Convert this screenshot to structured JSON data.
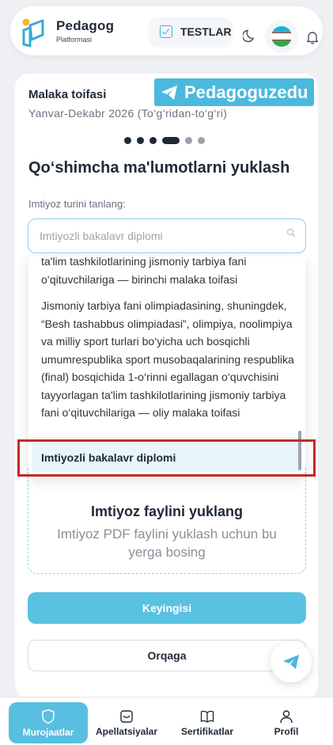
{
  "header": {
    "brand_title": "Pedagog",
    "brand_sub": "Platformasi",
    "tests_label": "TESTLAR",
    "icons": [
      "logo-icon",
      "checkbox-icon",
      "moon-icon",
      "uzbekistan-flag-icon",
      "bell-icon"
    ]
  },
  "slider": {
    "title": "Malaka toifasi",
    "subtitle": "Yanvar-Dekabr 2026 (To‘g‘ridan-to‘g‘ri)",
    "watermark": "Pedagoguzedu"
  },
  "form": {
    "section_title": "Qo‘shimcha ma'lumotlarni yuklash",
    "field_label": "Imtiyoz turini tanlang:",
    "select_placeholder": "Imtiyozli bakalavr diplomi"
  },
  "dropdown": {
    "options": [
      "ta'lim tashkilotlarining jismoniy tarbiya fani o‘qituvchilariga — birinchi malaka toifasi",
      "Jismoniy tarbiya fani olimpiadasining, shuningdek, “Besh tashabbus olimpiadasi”, olimpiya, noolimpiya va milliy sport turlari bo‘yicha uch bosqichli umumrespublika sport musobaqalarining respublika (final) bosqichida 1-o‘rinni egallagan o‘quvchisini tayyorlagan ta'lim tashkilotlarining jismoniy tarbiya fani o‘qituvchilariga — oliy malaka toifasi"
    ],
    "selected": "Imtiyozli bakalavr diplomi"
  },
  "upload": {
    "title": "Imtiyoz faylini yuklang",
    "subtitle": "Imtiyoz PDF faylini yuklash uchun bu yerga bosing"
  },
  "buttons": {
    "next": "Keyingisi",
    "back": "Orqaga"
  },
  "bottom_nav": {
    "items": [
      {
        "label": "Murojaatlar",
        "active": true
      },
      {
        "label": "Apellatsiyalar",
        "active": false
      },
      {
        "label": "Sertifikatlar",
        "active": false
      },
      {
        "label": "Profil",
        "active": false
      }
    ]
  },
  "colors": {
    "accent": "#58bfe0",
    "highlight_border": "#c62828",
    "selected_bg": "#e8f6fc"
  }
}
